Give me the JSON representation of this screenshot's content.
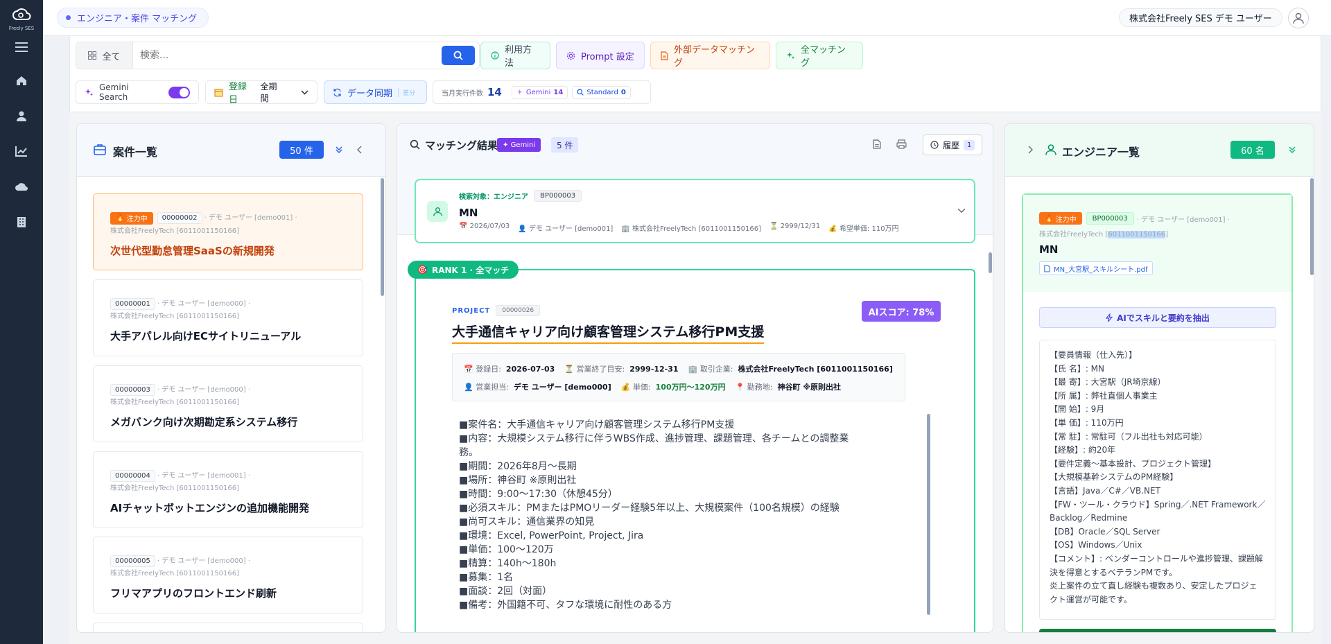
{
  "app": {
    "logo_text": "Freely SES",
    "title": "エンジニア・案件 マッチング",
    "user": "株式会社Freely SES デモ ユーザー"
  },
  "toolbar": {
    "scope": "全て",
    "search_placeholder": "検索...",
    "help": "利用方法",
    "prompt": "Prompt 設定",
    "external": "外部データマッチング",
    "all_match": "全マッチング",
    "gemini_search": "Gemini Search",
    "date_label": "登録日",
    "date_value": "全期間",
    "sync": "データ同期",
    "sync_sub": "差分",
    "exec_label": "当月実行件数",
    "exec_count": "14",
    "gemini_label": "Gemini",
    "gemini_count": "14",
    "standard_label": "Standard",
    "standard_count": "0"
  },
  "projects": {
    "title": "案件一覧",
    "count": "50 件",
    "items": [
      {
        "tag": "注力中",
        "id": "00000002",
        "meta1": "· デモ ユーザー [demo001] ·",
        "meta2": "株式会社FreelyTech [6011001150166]",
        "title": "次世代型勤怠管理SaaSの新規開発"
      },
      {
        "tag": "",
        "id": "00000001",
        "meta1": "· デモ ユーザー [demo000] ·",
        "meta2": "株式会社FreelyTech [6011001150166]",
        "title": "大手アパレル向けECサイトリニューアル"
      },
      {
        "tag": "",
        "id": "00000003",
        "meta1": "· デモ ユーザー [demo000] ·",
        "meta2": "株式会社FreelyTech [6011001150166]",
        "title": "メガバンク向け次期勘定系システム移行"
      },
      {
        "tag": "",
        "id": "00000004",
        "meta1": "· デモ ユーザー [demo001] ·",
        "meta2": "株式会社FreelyTech [6011001150166]",
        "title": "AIチャットボットエンジンの追加機能開発"
      },
      {
        "tag": "",
        "id": "00000005",
        "meta1": "· デモ ユーザー [demo000] ·",
        "meta2": "株式会社FreelyTech [6011001150166]",
        "title": "フリマアプリのフロントエンド刷新"
      }
    ]
  },
  "matching": {
    "title": "マッチング結果",
    "gemini_badge": "Gemini",
    "count": "5 件",
    "history": "履歴",
    "history_count": "1",
    "target": {
      "label": "検索対象：エンジニア",
      "id": "BP000003",
      "name": "MN",
      "date": "2026/07/03",
      "owner": "デモ ユーザー [demo001]",
      "company": "株式会社FreelyTech [6011001150166]",
      "end": "2999/12/31",
      "price": "希望単価: 110万円"
    },
    "result": {
      "rank": "RANK 1 · 全マッチ",
      "project_label": "PROJECT",
      "project_id": "00000026",
      "ai_score": "AIスコア: 78%",
      "title": "大手通信キャリア向け顧客管理システム移行PM支援",
      "reg_label": "登録日:",
      "reg": "2026-07-03",
      "end_label": "営業終了目安:",
      "end": "2999-12-31",
      "partner_label": "取引企業:",
      "partner": "株式会社FreelyTech [6011001150166]",
      "sales_label": "営業担当:",
      "sales": "デモ ユーザー [demo000]",
      "price_label": "単価:",
      "price": "100万円〜120万円",
      "loc_label": "勤務地:",
      "loc": "神谷町 ※原則出社",
      "desc": [
        "■案件名：大手通信キャリア向け顧客管理システム移行PM支援",
        "■内容：大規模システム移行に伴うWBS作成、進捗管理、課題管理、各チームとの調整業",
        "務。",
        "■期間：2026年8月〜長期",
        "■場所：神谷町 ※原則出社",
        "■時間：9:00〜17:30（休憩45分）",
        "■必須スキル：PMまたはPMOリーダー経験5年以上、大規模案件（100名規模）の経験",
        "■尚可スキル：通信業界の知見",
        "■環境：Excel, PowerPoint, Project, Jira",
        "■単価：100〜120万",
        "■精算：140h〜180h",
        "■募集：1名",
        "■面談：2回（対面）",
        "■備考：外国籍不可、タフな環境に耐性のある方"
      ]
    }
  },
  "engineers": {
    "title": "エンジニア一覧",
    "count": "60 名",
    "selected": {
      "tag": "注力中",
      "id": "BP000003",
      "meta1": "· デモ ユーザー [demo001] ·",
      "meta2_pre": "株式会社FreelyTech [",
      "meta2_hl": "6011001150166",
      "meta2_post": "]",
      "name": "MN",
      "file": "MN_大宮駅_スキルシート.pdf",
      "ai_button": "AIでスキルと要約を抽出",
      "lines": [
        "【要員情報（仕入先）】",
        "【氏 名】: MN",
        "【最 寄】: 大宮駅（JR埼京線）",
        "【所 属】: 弊社直個人事業主",
        "【開 始】: 9月",
        "【単 価】: 110万円",
        "【常 駐】: 常駐可（フル出社も対応可能）",
        "【経験】: 約20年",
        "【要件定義〜基本設計、プロジェクト管理】",
        "【大規模基幹システムのPM経験】",
        "【言語】Java／C#／VB.NET",
        "【FW・ツール・クラウド】Spring／.NET Framework／",
        "Backlog／Redmine",
        "【DB】Oracle／SQL Server",
        "【OS】Windows／Unix",
        "【コメント】: ベンダーコントロールや進捗管理、課題解",
        "決を得意とするベテランPMです。",
        "炎上案件の立て直し経験も複数あり、安定したプロジェ",
        "クト運営が可能です。"
      ]
    }
  },
  "colors": {
    "rail": "#1e2a3b",
    "primary": "#2563eb",
    "green": "#16a34a",
    "teal": "#10b981",
    "purple": "#7c3aed",
    "orange": "#f97316"
  }
}
